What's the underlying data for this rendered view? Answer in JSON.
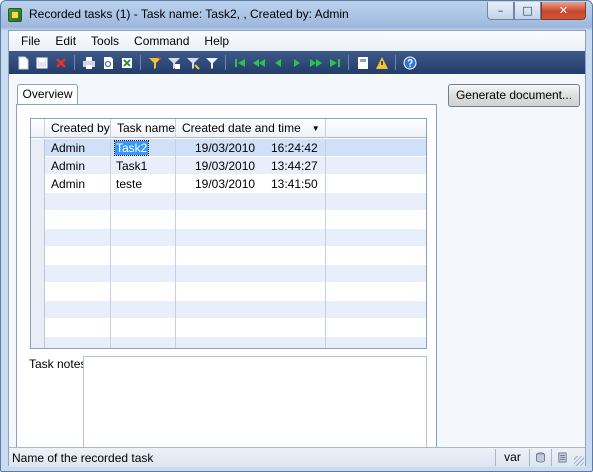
{
  "window": {
    "title": "Recorded tasks (1) - Task name: Task2, , Created by: Admin",
    "minimize_label": "–",
    "maximize_label": "□",
    "close_label": "✕"
  },
  "menu": [
    "File",
    "Edit",
    "Tools",
    "Command",
    "Help"
  ],
  "toolbar_icons": [
    "new-icon",
    "save-icon",
    "delete-icon",
    "print-icon",
    "print-preview-icon",
    "export-excel-icon",
    "filter-by-selection-icon",
    "filter-by-grid-icon",
    "advanced-filter-icon",
    "remove-filter-icon",
    "first-record-icon",
    "previous-page-icon",
    "previous-record-icon",
    "next-record-icon",
    "next-page-icon",
    "last-record-icon",
    "document-handling-icon",
    "alert-icon",
    "help-icon"
  ],
  "tabs": [
    {
      "label": "Overview"
    }
  ],
  "actions": {
    "generate_document_label": "Generate document..."
  },
  "grid": {
    "columns": [
      "Created by",
      "Task name",
      "Created date and time"
    ],
    "sorted_column": "Created date and time",
    "sort_indicator": "▼",
    "rows": [
      {
        "created_by": "Admin",
        "task_name": "Task2",
        "date": "19/03/2010",
        "time": "16:24:42",
        "selected": true
      },
      {
        "created_by": "Admin",
        "task_name": "Task1",
        "date": "19/03/2010",
        "time": "13:44:27",
        "selected": false
      },
      {
        "created_by": "Admin",
        "task_name": "teste",
        "date": "19/03/2010",
        "time": "13:41:50",
        "selected": false
      }
    ]
  },
  "notes": {
    "label": "Task notes:",
    "value": ""
  },
  "status": {
    "text": "Name of the recorded task",
    "company": "var"
  },
  "colors": {
    "toolbar_bg": "#2f4a78",
    "selection": "#3399ff",
    "row_alt": "#e8eefa"
  }
}
